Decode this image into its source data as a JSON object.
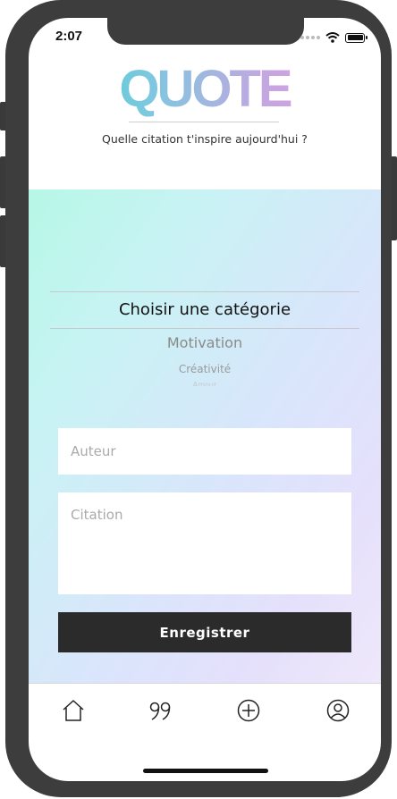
{
  "status": {
    "time": "2:07"
  },
  "header": {
    "logo": "QUOTE",
    "tagline": "Quelle citation t'inspire aujourd'hui ?"
  },
  "category_picker": {
    "selected": "Choisir une catégorie",
    "options": [
      "Motivation",
      "Créativité",
      "Amour"
    ]
  },
  "form": {
    "author_placeholder": "Auteur",
    "author_value": "",
    "quote_placeholder": "Citation",
    "quote_value": "",
    "save_label": "Enregistrer"
  },
  "tabs": [
    {
      "icon": "home-icon"
    },
    {
      "icon": "quote-icon"
    },
    {
      "icon": "add-icon"
    },
    {
      "icon": "profile-icon"
    }
  ],
  "colors": {
    "frame": "#3d3d3d",
    "logo_gradient_start": "#3fd4cb",
    "logo_gradient_end": "#e7a6d6",
    "button": "#2b2b2b"
  }
}
